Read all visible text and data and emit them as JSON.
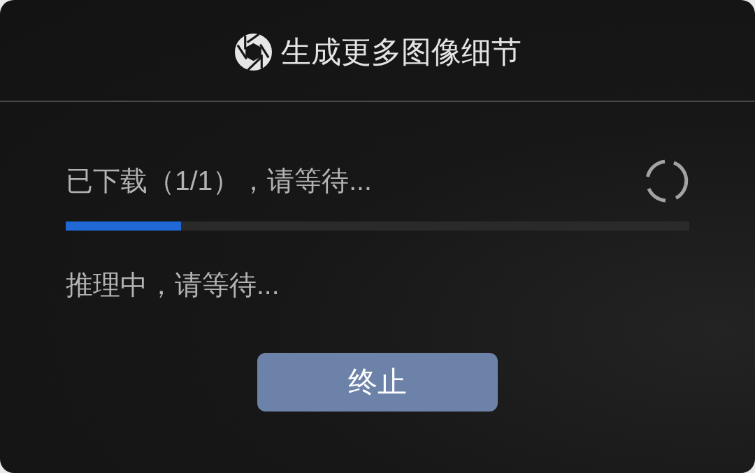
{
  "dialog": {
    "title": "生成更多图像细节"
  },
  "download": {
    "label": "已下载（1/1），请等待...",
    "level": 0.185
  },
  "status": {
    "text": "推理中，请等待..."
  },
  "buttons": [
    {
      "label": "终止"
    }
  ]
}
